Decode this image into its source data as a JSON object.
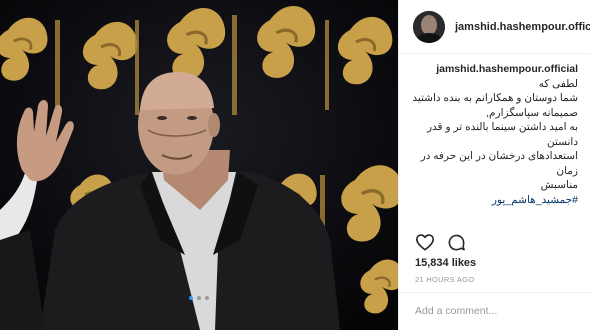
{
  "post": {
    "username": "jamshid.hashempour.official",
    "caption_username": "jamshid.hashempour.official",
    "caption_lines": [
      "لطفی که",
      "شما دوستان و همکارانم به بنده داشتید",
      "صمیمانه سپاسگزارم,",
      "به امید داشتن سینما بالنده تر و قدر دانستن",
      "استعدادهای درخشان در این حرفه در زمان",
      "مناسبش"
    ],
    "hashtag": "#جمشید_هاشم_پور",
    "likes": "15,834 likes",
    "time": "21 HOURS AGO",
    "comment_placeholder": "Add a comment...",
    "carousel": {
      "count": 3,
      "active": 1
    }
  },
  "icons": {
    "like": "heart-icon",
    "comment": "comment-bubble-icon"
  },
  "colors": {
    "accent": "#3897f0",
    "text": "#262626",
    "muted": "#999999",
    "hashtag": "#003569",
    "gold": "#c9a04a"
  }
}
